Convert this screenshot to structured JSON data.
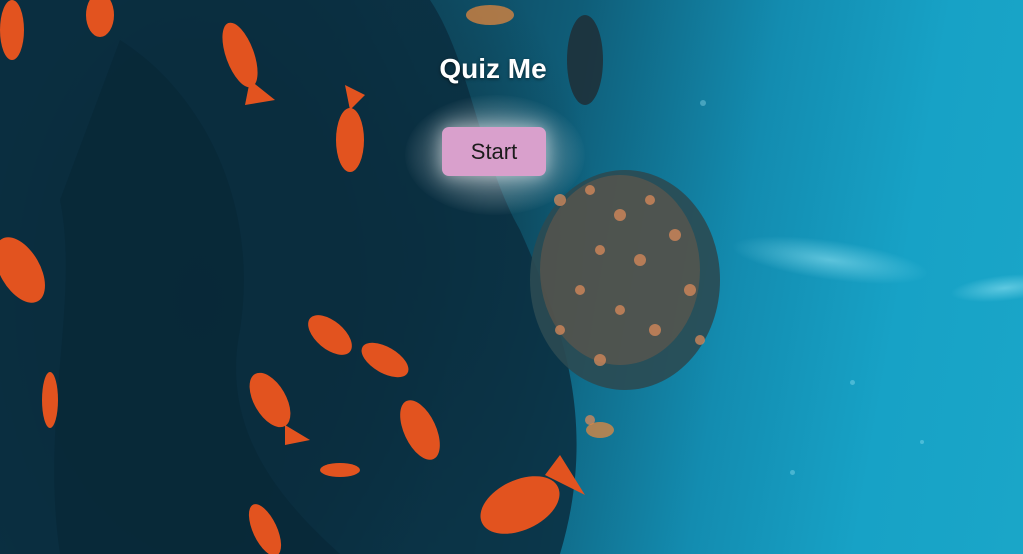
{
  "quiz": {
    "title": "Quiz Me",
    "start_label": "Start"
  },
  "colors": {
    "water_deep": "#0e3d52",
    "water_light": "#17a2c6",
    "fish": "#e2531f",
    "button_bg": "#d9a0cc",
    "title_text": "#ffffff"
  },
  "background": {
    "icon": "underwater-reef-photo"
  }
}
